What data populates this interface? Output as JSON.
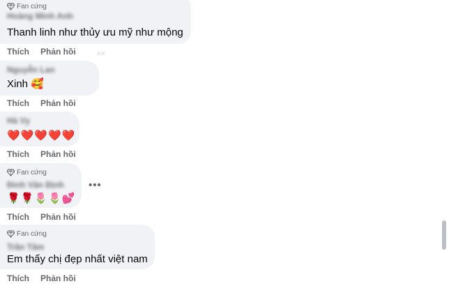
{
  "badge_label": "Fan cứng",
  "actions": {
    "like": "Thích",
    "reply": "Phản hồi"
  },
  "comments": [
    {
      "badge": "Fan cứng",
      "name": "Hoàng Minh Anh",
      "text": "Thanh linh như thủy ưu mỹ như mộng"
    },
    {
      "name": "Nguyễn Lan",
      "text": "Xinh 🥰"
    },
    {
      "name": "Hà Vy",
      "text": "❤️❤️❤️❤️❤️"
    },
    {
      "badge": "Fan cứng",
      "name": "Đinh Văn Định",
      "text": "🌹🌹🌷🌷💕"
    },
    {
      "badge": "Fan cứng",
      "name": "Trần Tâm",
      "text": "Em thấy chị đẹp nhất việt nam"
    }
  ],
  "colors": {
    "bubble": "#f0f2f5",
    "muted": "#65676b",
    "text": "#050505",
    "scrollbar": "#bcc0c4"
  },
  "icons": [
    "diamond-icon",
    "more-options-icon"
  ]
}
